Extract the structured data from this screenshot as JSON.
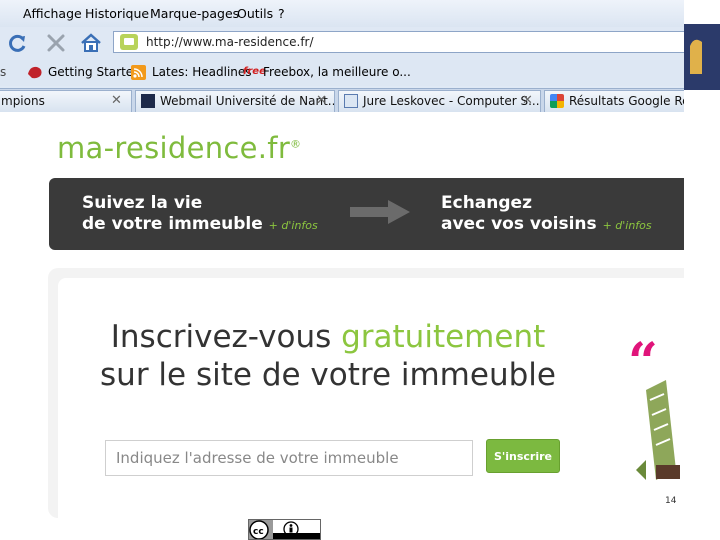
{
  "menu": [
    "Affichage",
    "Historique",
    "Marque-pages",
    "Outils",
    "?"
  ],
  "url": "http://www.ma-residence.fr/",
  "bookmarks": [
    "Getting Started",
    "Lates: Headlines",
    "Freebox, la meilleure o..."
  ],
  "tabs": [
    "mpions",
    "Webmail Université de Nant...",
    "Jure Leskovec - Computer S...",
    "Résultats Google Rech"
  ],
  "logo": {
    "text": "ma-residence.fr",
    "mark": "®"
  },
  "banner": {
    "left_line1": "Suivez la vie",
    "left_line2": "de votre immeuble",
    "left_info": "+ d'infos",
    "right_line1": "Echangez",
    "right_line2": "avec vos voisins",
    "right_info": "+ d'infos"
  },
  "headline": {
    "part1": "Inscrivez-vous ",
    "highlight": "gratuitement",
    "line2": "sur le site de votre immeuble"
  },
  "address_input": {
    "placeholder": "Indiquez l'adresse de votre immeuble"
  },
  "signup_button": "S'inscrire",
  "page_number": "14",
  "colors": {
    "brand_green": "#8cc63f",
    "banner_bg": "#3a3a3a"
  }
}
